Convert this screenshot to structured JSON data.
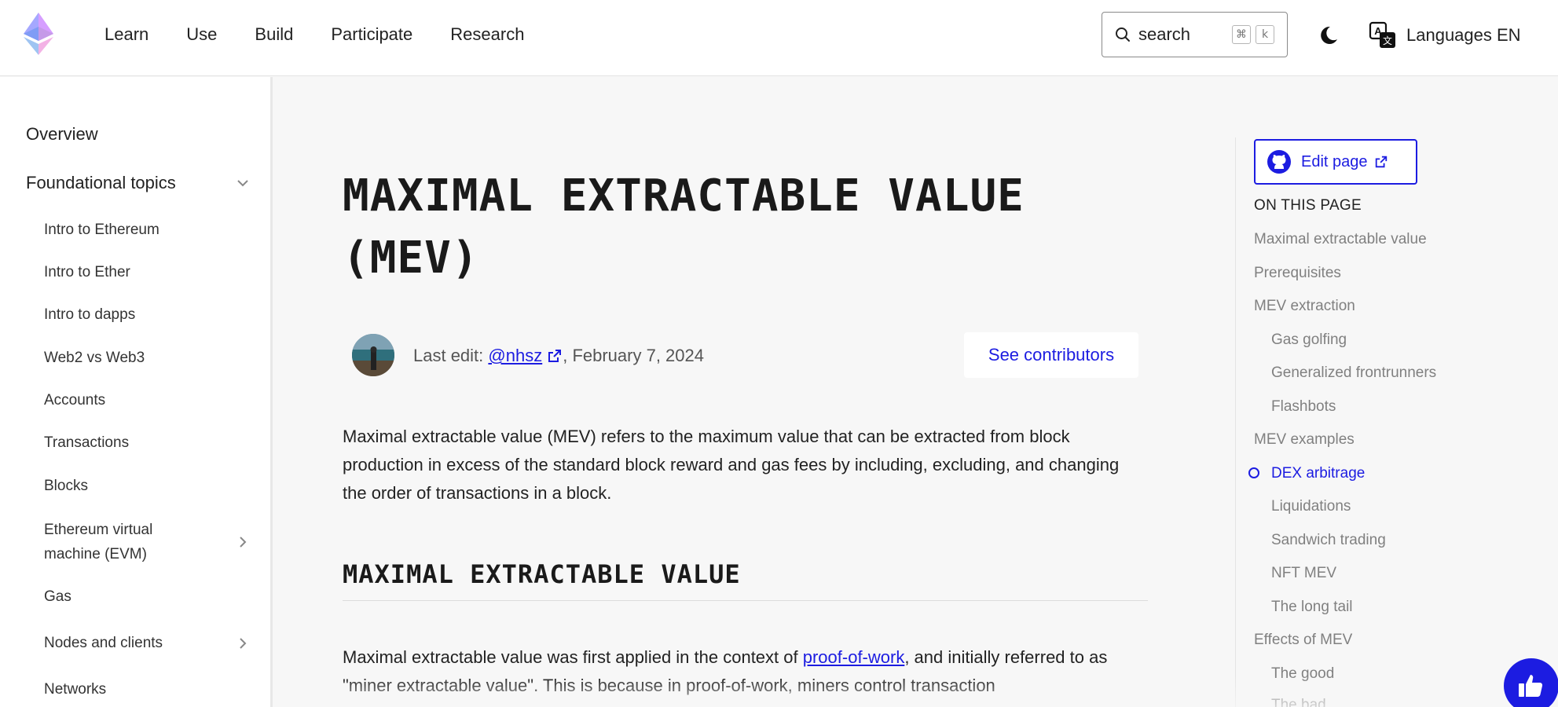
{
  "header": {
    "nav": [
      "Learn",
      "Use",
      "Build",
      "Participate",
      "Research"
    ],
    "search": {
      "label": "search",
      "kbd_1": "⌘",
      "kbd_2": "k"
    },
    "language": "Languages EN"
  },
  "sidebar": {
    "overview": "Overview",
    "section": "Foundational topics",
    "items": [
      {
        "label": "Intro to Ethereum"
      },
      {
        "label": "Intro to Ether"
      },
      {
        "label": "Intro to dapps"
      },
      {
        "label": "Web2 vs Web3"
      },
      {
        "label": "Accounts"
      },
      {
        "label": "Transactions"
      },
      {
        "label": "Blocks"
      },
      {
        "label": "Ethereum virtual machine (EVM)"
      },
      {
        "label": "Gas"
      },
      {
        "label": "Nodes and clients"
      },
      {
        "label": "Networks"
      }
    ]
  },
  "main": {
    "title": "MAXIMAL EXTRACTABLE VALUE (MEV)",
    "last_edit_prefix": "Last edit:",
    "last_edit_user": "@nhsz",
    "last_edit_date": ", February 7, 2024",
    "contributors_button": "See contributors",
    "intro": "Maximal extractable value (MEV) refers to the maximum value that can be extracted from block production in excess of the standard block reward and gas fees by including, excluding, and changing the order of transactions in a block.",
    "section_heading": "MAXIMAL EXTRACTABLE VALUE",
    "para2_before": "Maximal extractable value was first applied in the context of ",
    "para2_link": "proof-of-work",
    "para2_after": ", and initially referred to as \"miner extractable value\". This is because in proof-of-work, miners control transaction"
  },
  "toc": {
    "edit_button": "Edit page",
    "heading": "ON THIS PAGE",
    "items": [
      {
        "label": "Maximal extractable value"
      },
      {
        "label": "Prerequisites"
      },
      {
        "label": "MEV extraction"
      },
      {
        "label": "Gas golfing"
      },
      {
        "label": "Generalized frontrunners"
      },
      {
        "label": "Flashbots"
      },
      {
        "label": "MEV examples"
      },
      {
        "label": "DEX arbitrage"
      },
      {
        "label": "Liquidations"
      },
      {
        "label": "Sandwich trading"
      },
      {
        "label": "NFT MEV"
      },
      {
        "label": "The long tail"
      },
      {
        "label": "Effects of MEV"
      },
      {
        "label": "The good"
      },
      {
        "label": "The bad"
      }
    ],
    "active_item": "DEX arbitrage"
  },
  "colors": {
    "accent": "#1c1ce1",
    "background": "#f7f7f7",
    "text": "#1f1f1f",
    "muted": "#808080"
  },
  "icons": [
    "ethereum-logo",
    "search-icon",
    "moon-icon",
    "translate-icon",
    "chevron-down-icon",
    "chevron-right-icon",
    "github-icon",
    "external-link-icon",
    "thumbs-up-icon"
  ]
}
